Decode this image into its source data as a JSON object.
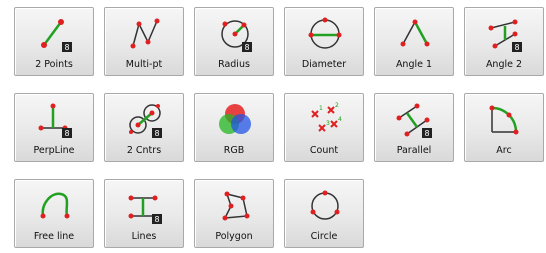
{
  "toolbar": {
    "tools": [
      {
        "label": "2 Points",
        "icon": "two-points-icon"
      },
      {
        "label": "Multi-pt",
        "icon": "multi-point-icon"
      },
      {
        "label": "Radius",
        "icon": "radius-icon"
      },
      {
        "label": "Diameter",
        "icon": "diameter-icon"
      },
      {
        "label": "Angle 1",
        "icon": "angle-one-icon"
      },
      {
        "label": "Angle 2",
        "icon": "angle-two-icon"
      },
      {
        "label": "PerpLine",
        "icon": "perpendicular-line-icon"
      },
      {
        "label": "2 Cntrs",
        "icon": "two-centers-icon"
      },
      {
        "label": "RGB",
        "icon": "rgb-icon"
      },
      {
        "label": "Count",
        "icon": "count-icon"
      },
      {
        "label": "Parallel",
        "icon": "parallel-icon"
      },
      {
        "label": "Arc",
        "icon": "arc-icon"
      },
      {
        "label": "Free line",
        "icon": "free-line-icon"
      },
      {
        "label": "Lines",
        "icon": "lines-icon"
      },
      {
        "label": "Polygon",
        "icon": "polygon-icon"
      },
      {
        "label": "Circle",
        "icon": "circle-icon"
      }
    ]
  },
  "colors": {
    "point": "#e02020",
    "line": "#22a022",
    "outline": "#333333",
    "badge": "#222222"
  }
}
